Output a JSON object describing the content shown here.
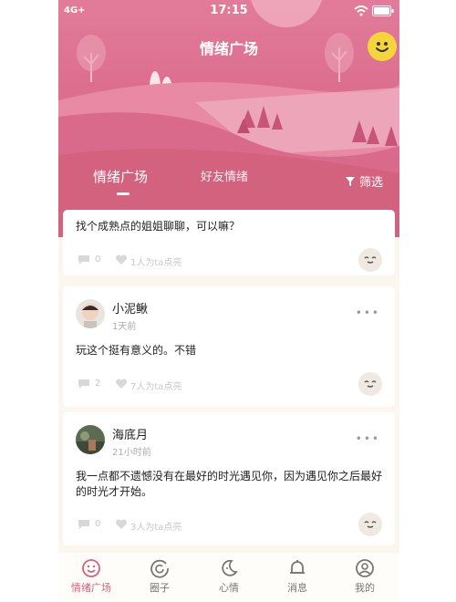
{
  "status_bar": {
    "carrier": "4G+",
    "time": "17:15"
  },
  "header": {
    "title": "情绪广场"
  },
  "tabs": [
    {
      "label": "情绪广场",
      "active": true
    },
    {
      "label": "好友情绪",
      "active": false
    }
  ],
  "filter": {
    "label": "筛选"
  },
  "posts": [
    {
      "text": "找个成熟点的姐姐聊聊，可以嘛？",
      "comments": "0",
      "likes": "1人为ta点亮"
    },
    {
      "username": "小泥鳅",
      "time": "1天前",
      "text": "玩这个挺有意义的。不错",
      "comments": "2",
      "likes": "7人为ta点亮"
    },
    {
      "username": "海底月",
      "time": "21小时前",
      "text": "我一点都不遗憾没有在最好的时光遇见你，因为遇见你之后最好的时光才开始。",
      "comments": "0",
      "likes": "3人为ta点亮"
    }
  ],
  "bottom_nav": [
    {
      "label": "情绪广场",
      "icon": "smile-icon",
      "active": true
    },
    {
      "label": "圈子",
      "icon": "circle-icon",
      "active": false
    },
    {
      "label": "心情",
      "icon": "moon-icon",
      "active": false
    },
    {
      "label": "消息",
      "icon": "bell-icon",
      "active": false
    },
    {
      "label": "我的",
      "icon": "user-icon",
      "active": false
    }
  ],
  "colors": {
    "accent": "#d65f84",
    "hero_pink": "#db6c8c",
    "smile_yellow": "#f5d53c"
  }
}
